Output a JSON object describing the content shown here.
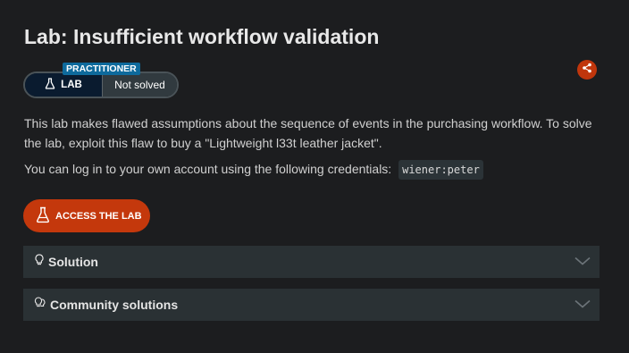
{
  "page": {
    "title": "Lab: Insufficient workflow validation"
  },
  "badge": {
    "level": "PRACTITIONER",
    "lab_label": "LAB",
    "status": "Not solved"
  },
  "description": {
    "paragraph1": "This lab makes flawed assumptions about the sequence of events in the purchasing workflow. To solve the lab, exploit this flaw to buy a \"Lightweight l33t leather jacket\".",
    "paragraph2": "You can log in to your own account using the following credentials:",
    "credentials": "wiener:peter"
  },
  "access_button": {
    "label": "ACCESS THE LAB"
  },
  "accordions": [
    {
      "label": "Solution",
      "icon": "lightbulb-icon"
    },
    {
      "label": "Community solutions",
      "icon": "community-lightbulbs-icon"
    }
  ],
  "colors": {
    "background": "#1c1d1f",
    "accent": "#c4380c",
    "level_tag": "#0e6a9c",
    "accordion_bg": "#2a3134"
  }
}
